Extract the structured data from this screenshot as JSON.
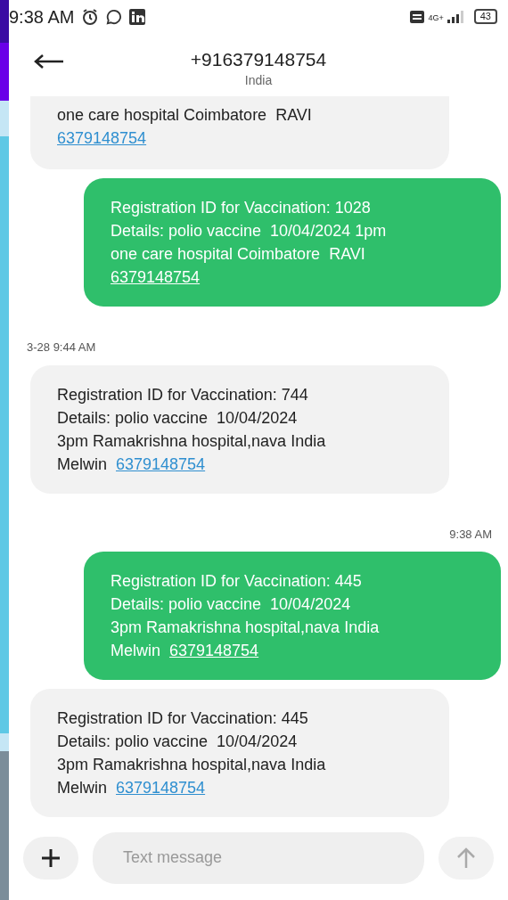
{
  "status_bar": {
    "time": "9:38 AM",
    "network": "4G+",
    "battery": "43"
  },
  "header": {
    "title": "+916379148754",
    "subtitle": "India"
  },
  "messages": [
    {
      "kind": "incoming",
      "partial": true,
      "text": "one care hospital Coimbatore  RAVI\n",
      "link": "6379148754"
    },
    {
      "kind": "outgoing",
      "partial": false,
      "text": "Registration ID for Vaccination: 1028\nDetails: polio vaccine  10/04/2024 1pm\none care hospital Coimbatore  RAVI\n",
      "link": "6379148754"
    },
    {
      "kind": "datestamp",
      "text": "3-28 9:44 AM"
    },
    {
      "kind": "incoming",
      "partial": false,
      "text": "Registration ID for Vaccination: 744\nDetails: polio vaccine  10/04/2024\n3pm Ramakrishna hospital,nava India\nMelwin  ",
      "link": "6379148754"
    },
    {
      "kind": "timestamp",
      "text": "9:38 AM"
    },
    {
      "kind": "outgoing",
      "partial": false,
      "text": "Registration ID for Vaccination: 445\nDetails: polio vaccine  10/04/2024\n3pm Ramakrishna hospital,nava India\nMelwin  ",
      "link": "6379148754"
    },
    {
      "kind": "incoming",
      "partial": false,
      "text": "Registration ID for Vaccination: 445\nDetails: polio vaccine  10/04/2024\n3pm Ramakrishna hospital,nava India\nMelwin  ",
      "link": "6379148754"
    }
  ],
  "composer": {
    "placeholder": "Text message"
  }
}
